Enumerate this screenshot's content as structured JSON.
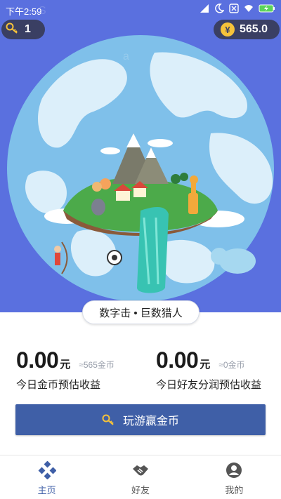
{
  "status_bar": {
    "time": "下午2:59",
    "icons": [
      "signal-icon",
      "moon-icon",
      "notification-off-icon",
      "wifi-icon",
      "battery-charging-icon"
    ]
  },
  "header": {
    "keys_count": "1",
    "coin_symbol": "¥",
    "coin_balance": "565.0"
  },
  "hero": {
    "game_title": "数字击 • 巨数猎人"
  },
  "stats": {
    "left": {
      "value": "0.00",
      "unit": "元",
      "approx": "≈565金币",
      "caption": "今日金币预估收益"
    },
    "right": {
      "value": "0.00",
      "unit": "元",
      "approx": "≈0金币",
      "caption": "今日好友分润预估收益"
    }
  },
  "play_button": {
    "label": "玩游赢金币"
  },
  "tabs": [
    {
      "label": "主页",
      "icon": "home-icon",
      "active": true
    },
    {
      "label": "好友",
      "icon": "handshake-icon",
      "active": false
    },
    {
      "label": "我的",
      "icon": "profile-icon",
      "active": false
    }
  ],
  "colors": {
    "hero_background": "#5a70df",
    "globe_water": "#7fc0ea",
    "pill_background": "#3a3f63",
    "coin_gold": "#f6c23a",
    "primary_button": "#3f5fa7",
    "active_tab": "#3f5fa7"
  }
}
